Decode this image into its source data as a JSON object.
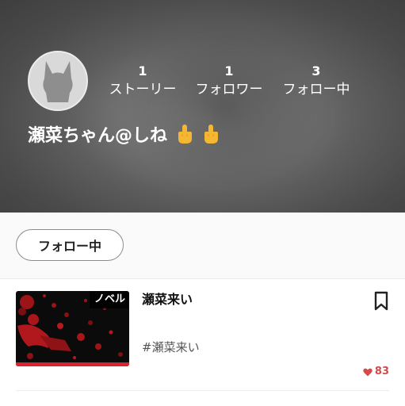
{
  "profile": {
    "username": "瀬菜ちゃん@しね",
    "avatar_icon": "cat-silhouette-icon",
    "emoji_icon": "middle-finger-emoji"
  },
  "stats": {
    "stories": {
      "count": "1",
      "label": "ストーリー"
    },
    "followers": {
      "count": "1",
      "label": "フォロワー"
    },
    "following": {
      "count": "3",
      "label": "フォロー中"
    }
  },
  "follow_button": {
    "label": "フォロー中"
  },
  "works": [
    {
      "badge": "ノベル",
      "title": "瀬菜来い",
      "tag": "#瀬菜来い",
      "likes": "83",
      "bookmark_icon": "bookmark-icon",
      "like_icon": "heart-icon"
    }
  ],
  "colors": {
    "accent": "#d9232e",
    "likes": "#d44a4a",
    "header_bg": "#6a6a6a"
  }
}
